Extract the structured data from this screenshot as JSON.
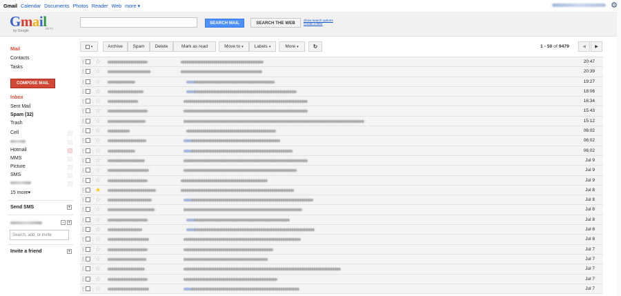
{
  "topbar": {
    "links": [
      "Gmail",
      "Calendar",
      "Documents",
      "Photos",
      "Reader",
      "Web",
      "more"
    ],
    "more_caret": "▾",
    "gear_icon": "gear-icon"
  },
  "header": {
    "logo_word": "Gmail",
    "logo_by": "by Google",
    "logo_beta": "BETA",
    "search_value": "",
    "search_mail_label": "SEARCH MAIL",
    "search_web_label": "SEARCH THE WEB",
    "show_options": "Show search options",
    "create_filter": "Create a filter"
  },
  "sidebar": {
    "mail": "Mail",
    "contacts": "Contacts",
    "tasks": "Tasks",
    "compose": "COMPOSE MAIL",
    "folders": {
      "inbox": "Inbox",
      "sent": "Sent Mail",
      "spam": "Spam (32)",
      "trash": "Trash"
    },
    "labels": [
      "Cell",
      "",
      "Hotmail",
      "MMS",
      "Picture",
      "SMS",
      ""
    ],
    "more_labels": "15 more▾",
    "send_sms": "Send SMS",
    "chat_placeholder": "Search, add, or invite",
    "invite": "Invite a friend",
    "plus": "+",
    "minus": "-"
  },
  "toolbar": {
    "archive": "Archive",
    "spam": "Spam",
    "delete": "Delete",
    "mark_read": "Mark as read",
    "move_to": "Move to",
    "labels": "Labels",
    "more": "More",
    "refresh_icon": "↻",
    "caret": "▾",
    "pager_range": "1 - 50",
    "pager_of": "of",
    "pager_total": "9479",
    "prev": "◀",
    "next": "▶"
  },
  "emails": [
    {
      "time": "20:47",
      "starred": false
    },
    {
      "time": "20:39",
      "starred": false
    },
    {
      "time": "19:27",
      "starred": false
    },
    {
      "time": "18:06",
      "starred": false
    },
    {
      "time": "16:34",
      "starred": false
    },
    {
      "time": "15:43",
      "starred": false
    },
    {
      "time": "15:12",
      "starred": false
    },
    {
      "time": "06:02",
      "starred": false
    },
    {
      "time": "06:02",
      "starred": false
    },
    {
      "time": "06:02",
      "starred": false
    },
    {
      "time": "Jul 9",
      "starred": false
    },
    {
      "time": "Jul 9",
      "starred": false
    },
    {
      "time": "Jul 9",
      "starred": false
    },
    {
      "time": "Jul 8",
      "starred": true
    },
    {
      "time": "Jul 8",
      "starred": false
    },
    {
      "time": "Jul 8",
      "starred": false
    },
    {
      "time": "Jul 8",
      "starred": false
    },
    {
      "time": "Jul 8",
      "starred": false
    },
    {
      "time": "Jul 8",
      "starred": false
    },
    {
      "time": "Jul 7",
      "starred": false
    },
    {
      "time": "Jul 7",
      "starred": false
    },
    {
      "time": "Jul 7",
      "starred": false
    },
    {
      "time": "Jul 7",
      "starred": false
    },
    {
      "time": "Jul 7",
      "starred": false
    }
  ],
  "colors": {
    "accent_red": "#dd4b39",
    "compose_red": "#d14836",
    "search_blue": "#4d90fe",
    "link_blue": "#1155cc",
    "star_yellow": "#f4c60c"
  }
}
